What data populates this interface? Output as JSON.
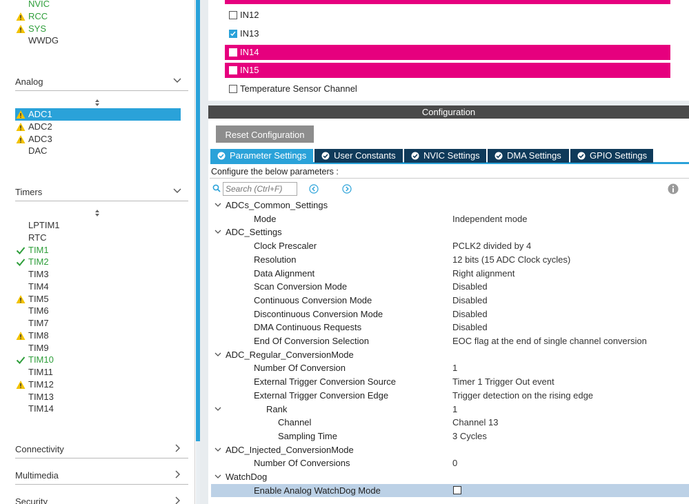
{
  "sidebar": {
    "system_items": [
      {
        "label": "NVIC",
        "status": "green",
        "icon": "none"
      },
      {
        "label": "RCC",
        "status": "green",
        "icon": "warning-icon"
      },
      {
        "label": "SYS",
        "status": "green",
        "icon": "warning-icon"
      },
      {
        "label": "WWDG",
        "status": "normal",
        "icon": "none"
      }
    ],
    "analog": {
      "title": "Analog",
      "items": [
        {
          "label": "ADC1",
          "status": "selected",
          "icon": "warning-icon"
        },
        {
          "label": "ADC2",
          "status": "normal",
          "icon": "warning-icon"
        },
        {
          "label": "ADC3",
          "status": "normal",
          "icon": "warning-icon"
        },
        {
          "label": "DAC",
          "status": "normal",
          "icon": "none"
        }
      ]
    },
    "timers": {
      "title": "Timers",
      "items": [
        {
          "label": "LPTIM1",
          "status": "normal",
          "icon": "none"
        },
        {
          "label": "RTC",
          "status": "normal",
          "icon": "none"
        },
        {
          "label": "TIM1",
          "status": "green",
          "icon": "check-icon"
        },
        {
          "label": "TIM2",
          "status": "green",
          "icon": "check-icon"
        },
        {
          "label": "TIM3",
          "status": "normal",
          "icon": "none"
        },
        {
          "label": "TIM4",
          "status": "normal",
          "icon": "none"
        },
        {
          "label": "TIM5",
          "status": "normal",
          "icon": "warning-icon"
        },
        {
          "label": "TIM6",
          "status": "normal",
          "icon": "none"
        },
        {
          "label": "TIM7",
          "status": "normal",
          "icon": "none"
        },
        {
          "label": "TIM8",
          "status": "normal",
          "icon": "warning-icon"
        },
        {
          "label": "TIM9",
          "status": "normal",
          "icon": "none"
        },
        {
          "label": "TIM10",
          "status": "green",
          "icon": "check-icon"
        },
        {
          "label": "TIM11",
          "status": "normal",
          "icon": "none"
        },
        {
          "label": "TIM12",
          "status": "normal",
          "icon": "warning-icon"
        },
        {
          "label": "TIM13",
          "status": "normal",
          "icon": "none"
        },
        {
          "label": "TIM14",
          "status": "normal",
          "icon": "none"
        }
      ]
    },
    "connectivity_title": "Connectivity",
    "multimedia_title": "Multimedia",
    "security_title": "Security"
  },
  "mode": {
    "rows": [
      {
        "label": "IN12",
        "checked": false,
        "highlight": false
      },
      {
        "label": "IN13",
        "checked": true,
        "highlight": false
      },
      {
        "label": "IN14",
        "checked": false,
        "highlight": true
      },
      {
        "label": "IN15",
        "checked": false,
        "highlight": true
      },
      {
        "label": "Temperature Sensor Channel",
        "checked": false,
        "highlight": false
      }
    ]
  },
  "config": {
    "title": "Configuration",
    "reset_label": "Reset Configuration",
    "tabs": [
      {
        "label": "Parameter Settings",
        "active": true
      },
      {
        "label": "User Constants",
        "active": false
      },
      {
        "label": "NVIC Settings",
        "active": false
      },
      {
        "label": "DMA Settings",
        "active": false
      },
      {
        "label": "GPIO Settings",
        "active": false
      }
    ],
    "configure_text": "Configure the below parameters :",
    "search_placeholder": "Search (Ctrl+F)",
    "params": [
      {
        "name": "ADCs_Common_Settings",
        "value": "",
        "level": 0,
        "group": true
      },
      {
        "name": "Mode",
        "value": "Independent mode",
        "level": 2
      },
      {
        "name": "ADC_Settings",
        "value": "",
        "level": 0,
        "group": true
      },
      {
        "name": "Clock Prescaler",
        "value": "PCLK2 divided by 4",
        "level": 2
      },
      {
        "name": "Resolution",
        "value": "12 bits (15 ADC Clock cycles)",
        "level": 2
      },
      {
        "name": "Data Alignment",
        "value": "Right alignment",
        "level": 2
      },
      {
        "name": "Scan Conversion Mode",
        "value": "Disabled",
        "level": 2
      },
      {
        "name": "Continuous Conversion Mode",
        "value": "Disabled",
        "level": 2
      },
      {
        "name": "Discontinuous Conversion Mode",
        "value": "Disabled",
        "level": 2
      },
      {
        "name": "DMA Continuous Requests",
        "value": "Disabled",
        "level": 2
      },
      {
        "name": "End Of Conversion Selection",
        "value": "EOC flag at the end of single channel conversion",
        "level": 2
      },
      {
        "name": "ADC_Regular_ConversionMode",
        "value": "",
        "level": 0,
        "group": true
      },
      {
        "name": "Number Of Conversion",
        "value": "1",
        "level": 2
      },
      {
        "name": "External Trigger Conversion Source",
        "value": "Timer 1 Trigger Out event",
        "level": 2
      },
      {
        "name": "External Trigger Conversion Edge",
        "value": "Trigger detection on the rising edge",
        "level": 2
      },
      {
        "name": "Rank",
        "value": "1",
        "level": 3,
        "group": true
      },
      {
        "name": "Channel",
        "value": "Channel 13",
        "level": 4
      },
      {
        "name": "Sampling Time",
        "value": "3 Cycles",
        "level": 4
      },
      {
        "name": "ADC_Injected_ConversionMode",
        "value": "",
        "level": 0,
        "group": true
      },
      {
        "name": "Number Of Conversions",
        "value": "0",
        "level": 2
      },
      {
        "name": "WatchDog",
        "value": "",
        "level": 0,
        "group": true
      },
      {
        "name": "Enable Analog WatchDog Mode",
        "value": "",
        "level": 2,
        "checkbox": true,
        "highlight": true
      }
    ]
  },
  "colors": {
    "accent": "#2aa2d9",
    "highlight_pink": "#e6007e",
    "green_status": "#2e9e3a",
    "warning": "#f2c200",
    "tab_dark": "#0f3a5a"
  }
}
